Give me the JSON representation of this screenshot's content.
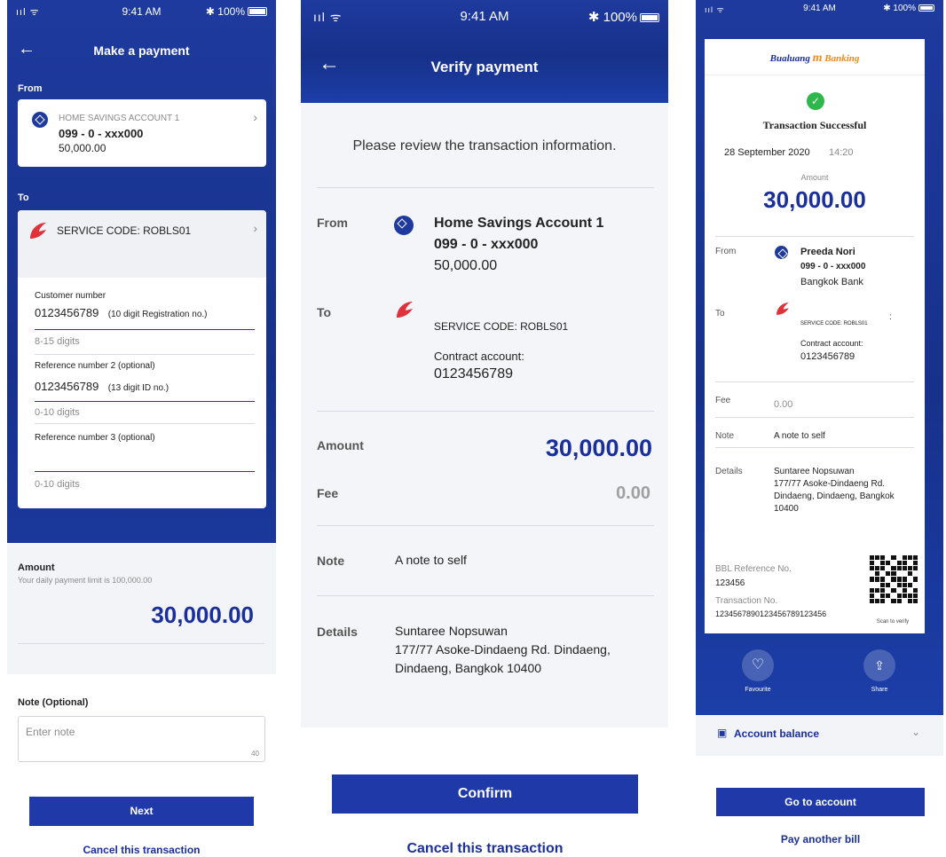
{
  "status": {
    "signal": "ııl ᯤ",
    "time": "9:41 AM",
    "battery": "✱ 100%"
  },
  "screen1": {
    "title": "Make a payment",
    "from_label": "From",
    "from_account_name": "HOME SAVINGS ACCOUNT 1",
    "from_account_number": "099 - 0 - xxx000",
    "from_balance": "50,000.00",
    "to_label": "To",
    "service_code": "SERVICE CODE: ROBLS01",
    "customer_number_label": "Customer number",
    "customer_number_value": "0123456789",
    "customer_number_hint_inline": "(10 digit Registration no.)",
    "customer_number_hint": "8-15 digits",
    "ref2_label": "Reference number 2 (optional)",
    "ref2_value": "0123456789",
    "ref2_hint_inline": "(13 digit ID no.)",
    "ref2_hint": "0-10 digits",
    "ref3_label": "Reference number 3 (optional)",
    "ref3_hint": "0-10 digits",
    "amount_label": "Amount",
    "amount_limit": "Your daily payment limit is 100,000.00",
    "amount_value": "30,000.00",
    "note_label": "Note (Optional)",
    "note_placeholder": "Enter note",
    "note_counter": "40",
    "next_button": "Next",
    "cancel_link": "Cancel this transaction"
  },
  "screen2": {
    "title": "Verify payment",
    "review_text": "Please review the transaction information.",
    "from_label": "From",
    "from_account_name": "Home Savings Account 1",
    "from_account_number": "099 - 0 - xxx000",
    "from_balance": "50,000.00",
    "to_label": "To",
    "service_code": "SERVICE CODE: ROBLS01",
    "contract_label": "Contract account:",
    "contract_value": "0123456789",
    "amount_label": "Amount",
    "amount_value": "30,000.00",
    "fee_label": "Fee",
    "fee_value": "0.00",
    "note_label": "Note",
    "note_value": "A note to self",
    "details_label": "Details",
    "details_line1": "Suntaree Nopsuwan",
    "details_line2": "177/77 Asoke-Dindaeng Rd. Dindaeng,",
    "details_line3": "Dindaeng, Bangkok 10400",
    "confirm_button": "Confirm",
    "cancel_link": "Cancel this transaction"
  },
  "screen3": {
    "brand_left": "Bualuang",
    "brand_mid": "m",
    "brand_right": "Banking",
    "success_title": "Transaction Successful",
    "date": "28 September 2020",
    "time": "14:20",
    "amount_label": "Amount",
    "amount_value": "30,000.00",
    "from_label": "From",
    "from_name": "Preeda Nori",
    "from_account_number": "099 - 0 - xxx000",
    "from_bank": "Bangkok Bank",
    "to_label": "To",
    "service_code": "SERVICE CODE: ROBLS01",
    "colon": ":",
    "contract_label": "Contract account:",
    "contract_value": "0123456789",
    "fee_label": "Fee",
    "fee_value": "0.00",
    "note_label": "Note",
    "note_value": "A note to self",
    "details_label": "Details",
    "details_line1": "Suntaree Nopsuwan",
    "details_line2": "177/77 Asoke-Dindaeng Rd.",
    "details_line3": "Dindaeng, Dindaeng, Bangkok",
    "details_line4": "10400",
    "ref_label": "BBL Reference No.",
    "ref_value": "123456",
    "txn_label": "Transaction No.",
    "txn_value": "123456789012345678912345​6",
    "scan_label": "Scan to verify",
    "favourite_label": "Favourite",
    "share_label": "Share",
    "account_balance": "Account balance",
    "go_button": "Go to account",
    "pay_another": "Pay another bill"
  },
  "colors": {
    "brand_blue": "#1e3a9e",
    "amount_navy": "#1a2f9a",
    "success_green": "#2eb84b",
    "krungsri_red": "#e0303a"
  }
}
